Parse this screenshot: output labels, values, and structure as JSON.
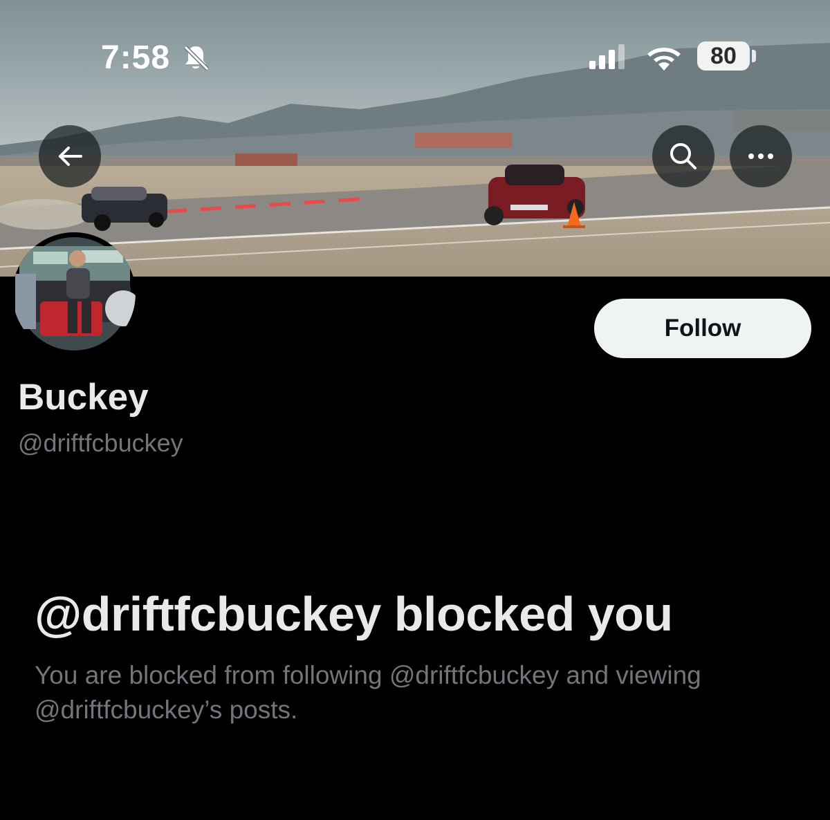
{
  "status_bar": {
    "time": "7:58",
    "battery_percent": "80",
    "icons": [
      "bell-slash-icon",
      "signal-icon",
      "wifi-icon",
      "battery-icon"
    ]
  },
  "nav": {
    "icons": [
      "arrow-left-icon",
      "search-icon",
      "more-horizontal-icon"
    ]
  },
  "profile": {
    "display_name": "Buckey",
    "handle": "@driftfcbuckey",
    "follow_label": "Follow"
  },
  "blocked": {
    "title": "@driftfcbuckey blocked you",
    "description": "You are blocked from following @driftfcbuckey and viewing @driftfcbuckey’s posts."
  },
  "colors": {
    "background": "#000000",
    "primary_text": "#e7e9ea",
    "secondary_text": "#71767b",
    "follow_button_bg": "#eff3f4"
  }
}
